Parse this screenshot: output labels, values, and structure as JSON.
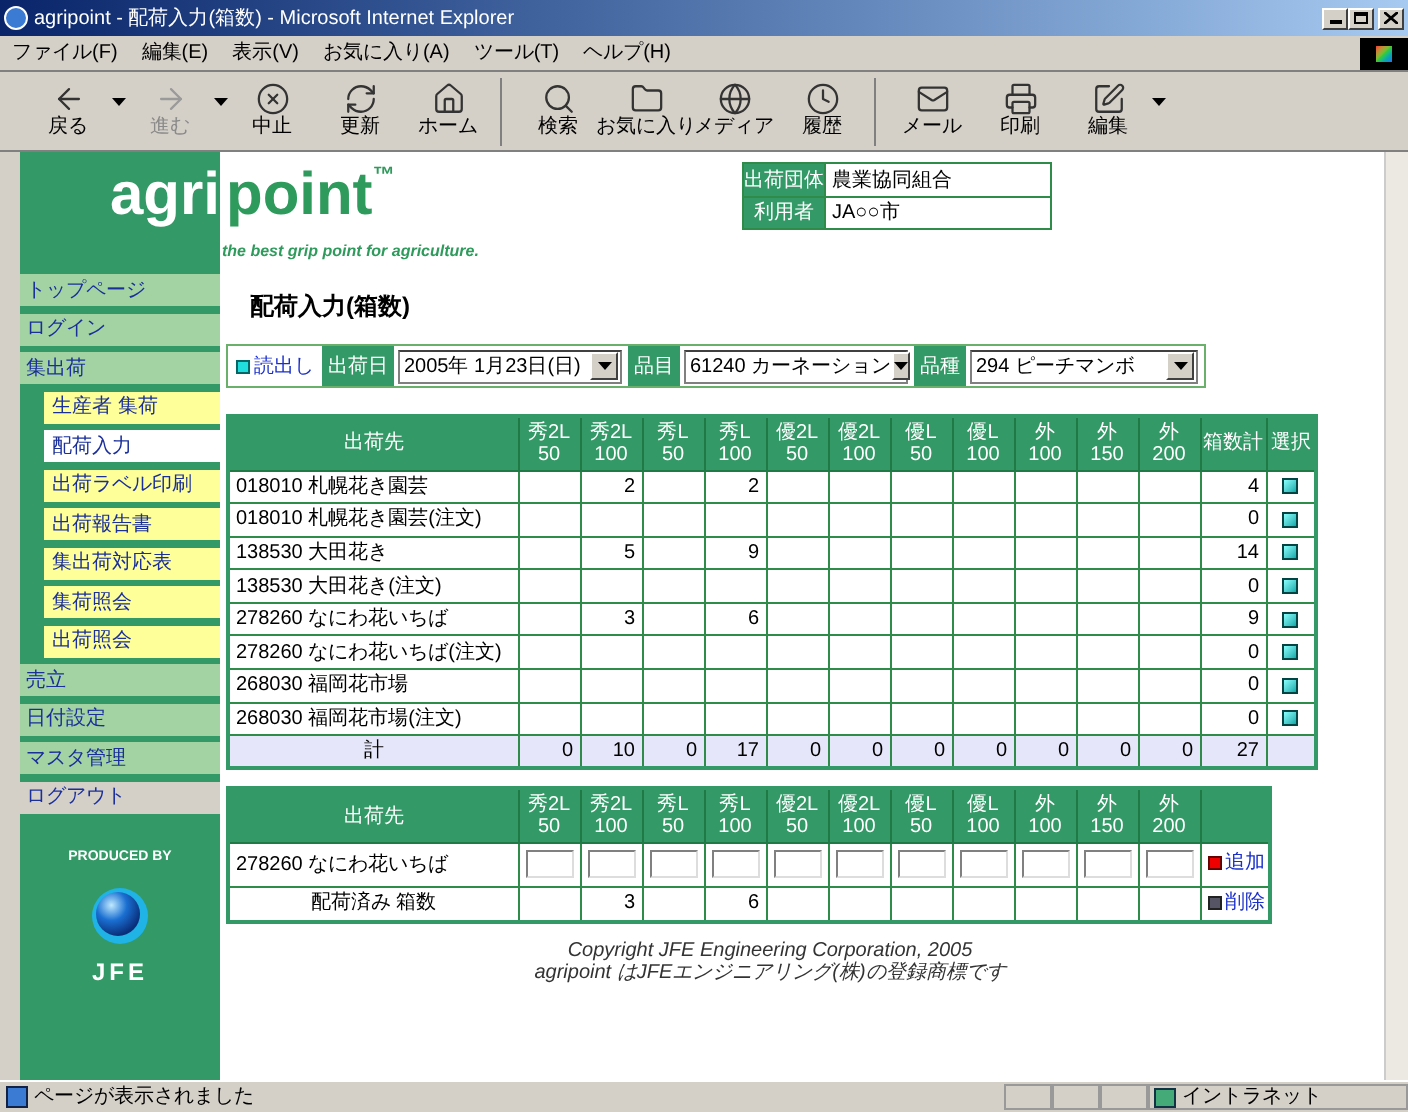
{
  "window": {
    "title": "agripoint - 配荷入力(箱数) - Microsoft Internet Explorer"
  },
  "menu": [
    "ファイル(F)",
    "編集(E)",
    "表示(V)",
    "お気に入り(A)",
    "ツール(T)",
    "ヘルプ(H)"
  ],
  "toolbar": [
    [
      {
        "label": "戻る",
        "kind": "back",
        "disabled": false,
        "dropdown": true
      },
      {
        "label": "進む",
        "kind": "forward",
        "disabled": true,
        "dropdown": true
      },
      {
        "label": "中止",
        "kind": "stop",
        "disabled": false,
        "dropdown": false
      },
      {
        "label": "更新",
        "kind": "refresh",
        "disabled": false,
        "dropdown": false
      },
      {
        "label": "ホーム",
        "kind": "home",
        "disabled": false,
        "dropdown": false
      }
    ],
    [
      {
        "label": "検索",
        "kind": "search",
        "disabled": false,
        "dropdown": false
      },
      {
        "label": "お気に入り",
        "kind": "favorites",
        "disabled": false,
        "dropdown": false
      },
      {
        "label": "メディア",
        "kind": "media",
        "disabled": false,
        "dropdown": false
      },
      {
        "label": "履歴",
        "kind": "history",
        "disabled": false,
        "dropdown": false
      }
    ],
    [
      {
        "label": "メール",
        "kind": "mail",
        "disabled": false,
        "dropdown": false
      },
      {
        "label": "印刷",
        "kind": "print",
        "disabled": false,
        "dropdown": false
      },
      {
        "label": "編集",
        "kind": "edit",
        "disabled": false,
        "dropdown": true
      }
    ]
  ],
  "logo": {
    "left": "agri",
    "right": "point",
    "mark": "™",
    "tagline": "the best grip point for agriculture."
  },
  "org_info": [
    {
      "label": "出荷団体",
      "value": "農業協同組合"
    },
    {
      "label": "利用者",
      "value": "JA○○市"
    }
  ],
  "sidebar": {
    "items": [
      {
        "label": "トップページ",
        "kind": "menu",
        "selected": false
      },
      {
        "label": "ログイン",
        "kind": "menu",
        "selected": false
      },
      {
        "label": "集出荷",
        "kind": "menu",
        "selected": false,
        "children": [
          {
            "label": "生産者 集荷",
            "selected": false
          },
          {
            "label": "配荷入力",
            "selected": true
          },
          {
            "label": "出荷ラベル印刷",
            "selected": false
          },
          {
            "label": "出荷報告書",
            "selected": false
          },
          {
            "label": "集出荷対応表",
            "selected": false
          },
          {
            "label": "集荷照会",
            "selected": false
          },
          {
            "label": "出荷照会",
            "selected": false
          }
        ]
      },
      {
        "label": "売立",
        "kind": "menu",
        "selected": false
      },
      {
        "label": "日付設定",
        "kind": "menu",
        "selected": false
      },
      {
        "label": "マスタ管理",
        "kind": "menu",
        "selected": false
      },
      {
        "label": "ログアウト",
        "kind": "logout",
        "selected": false
      }
    ]
  },
  "produced_by": {
    "label": "PRODUCED BY",
    "brand": "JFE"
  },
  "page_title": "配荷入力(箱数)",
  "filter": {
    "link": "読出し",
    "fields": [
      {
        "label": "出荷日",
        "value": "2005年 1月23日(日)"
      },
      {
        "label": "品目",
        "value": "61240 カーネーション"
      },
      {
        "label": "品種",
        "value": "294 ピーチマンボ"
      }
    ]
  },
  "table": {
    "first_column": "出荷先",
    "total_column": "箱数計",
    "select_column": "選択",
    "columns": [
      {
        "grade": "秀2L",
        "size": "50"
      },
      {
        "grade": "秀2L",
        "size": "100"
      },
      {
        "grade": "秀L",
        "size": "50"
      },
      {
        "grade": "秀L",
        "size": "100"
      },
      {
        "grade": "優2L",
        "size": "50"
      },
      {
        "grade": "優2L",
        "size": "100"
      },
      {
        "grade": "優L",
        "size": "50"
      },
      {
        "grade": "優L",
        "size": "100"
      },
      {
        "grade": "外",
        "size": "100"
      },
      {
        "grade": "外",
        "size": "150"
      },
      {
        "grade": "外",
        "size": "200"
      }
    ],
    "rows": [
      {
        "destination": "018010 札幌花き園芸",
        "values": {
          "1": "2",
          "3": "2"
        },
        "total": "4"
      },
      {
        "destination": "018010 札幌花き園芸(注文)",
        "total": "0"
      },
      {
        "destination": "138530 大田花き",
        "values": {
          "1": "5",
          "3": "9"
        },
        "total": "14"
      },
      {
        "destination": "138530 大田花き(注文)",
        "total": "0"
      },
      {
        "destination": "278260 なにわ花いちば",
        "values": {
          "1": "3",
          "3": "6"
        },
        "total": "9"
      },
      {
        "destination": "278260 なにわ花いちば(注文)",
        "total": "0"
      },
      {
        "destination": "268030 福岡花市場",
        "total": "0"
      },
      {
        "destination": "268030 福岡花市場(注文)",
        "total": "0"
      }
    ],
    "total_row": {
      "label": "計",
      "values": [
        "0",
        "10",
        "0",
        "17",
        "0",
        "0",
        "0",
        "0",
        "0",
        "0",
        "0"
      ],
      "total": "27"
    }
  },
  "entry_table": {
    "first_column": "出荷先",
    "columns": [
      {
        "grade": "秀2L",
        "size": "50"
      },
      {
        "grade": "秀2L",
        "size": "100"
      },
      {
        "grade": "秀L",
        "size": "50"
      },
      {
        "grade": "秀L",
        "size": "100"
      },
      {
        "grade": "優2L",
        "size": "50"
      },
      {
        "grade": "優2L",
        "size": "100"
      },
      {
        "grade": "優L",
        "size": "50"
      },
      {
        "grade": "優L",
        "size": "100"
      },
      {
        "grade": "外",
        "size": "100"
      },
      {
        "grade": "外",
        "size": "150"
      },
      {
        "grade": "外",
        "size": "200"
      }
    ],
    "rows": [
      {
        "kind": "input",
        "label": "278260 なにわ花いちば",
        "action": "追加"
      },
      {
        "kind": "values",
        "label": "配荷済み 箱数",
        "values": {
          "1": "3",
          "3": "6"
        },
        "action": "削除"
      }
    ]
  },
  "copyright": [
    "Copyright JFE Engineering Corporation, 2005",
    "agripoint はJFEエンジニアリング(株)の登録商標です"
  ],
  "status_bar": {
    "text": "ページが表示されました",
    "zone": "イントラネット"
  }
}
